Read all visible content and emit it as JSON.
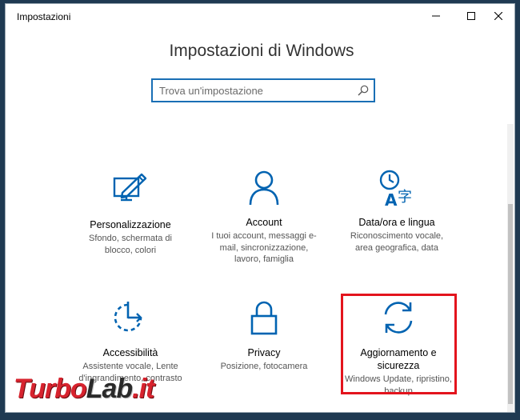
{
  "window": {
    "title": "Impostazioni"
  },
  "heading": "Impostazioni di Windows",
  "search": {
    "placeholder": "Trova un'impostazione",
    "value": ""
  },
  "tiles": [
    {
      "name": "Personalizzazione",
      "desc": "Sfondo, schermata di blocco, colori",
      "icon": "personalization-icon"
    },
    {
      "name": "Account",
      "desc": "I tuoi account, messaggi e-mail, sincronizzazione, lavoro, famiglia",
      "icon": "account-icon"
    },
    {
      "name": "Data/ora e lingua",
      "desc": "Riconoscimento vocale, area geografica, data",
      "icon": "time-language-icon"
    },
    {
      "name": "Accessibilità",
      "desc": "Assistente vocale, Lente d'ingrandimento, contrasto",
      "icon": "accessibility-icon"
    },
    {
      "name": "Privacy",
      "desc": "Posizione, fotocamera",
      "icon": "lock-icon"
    },
    {
      "name": "Aggiornamento e sicurezza",
      "desc": "Windows Update, ripristino, backup",
      "icon": "update-icon"
    }
  ],
  "watermark": {
    "part1": "Turbo",
    "part2": "Lab",
    "part3": ".it"
  },
  "colors": {
    "accent": "#0063b1",
    "highlight": "#e3141d",
    "search_border": "#1a6fb5"
  }
}
